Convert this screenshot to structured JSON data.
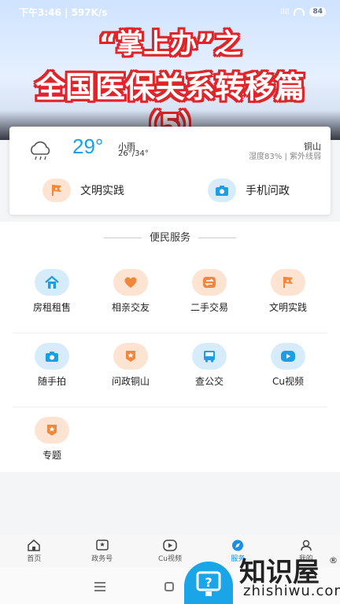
{
  "status_bar": {
    "time_speed": "下午3:46 | 597K/s",
    "signal": "llll",
    "battery": "84"
  },
  "banner": {
    "line1": "“掌上办”之",
    "line2": "全国医保关系转移篇",
    "line3": "（5）"
  },
  "weather": {
    "temperature": "29°",
    "condition": "小雨",
    "range": "26°/34°",
    "city": "铜山",
    "detail": "湿度83% | 紫外线弱",
    "icon": "cloud-rain-icon"
  },
  "quick_links": [
    {
      "label": "文明实践",
      "icon": "flag-icon"
    },
    {
      "label": "手机问政",
      "icon": "camera-icon"
    }
  ],
  "services": {
    "title": "便民服务",
    "rows": [
      [
        {
          "label": "房租租售",
          "icon": "house-icon",
          "tone": "blue"
        },
        {
          "label": "相亲交友",
          "icon": "heart-icon",
          "tone": "orange"
        },
        {
          "label": "二手交易",
          "icon": "exchange-icon",
          "tone": "orange"
        },
        {
          "label": "文明实践",
          "icon": "flag-icon",
          "tone": "orange"
        }
      ],
      [
        {
          "label": "随手拍",
          "icon": "camera-icon",
          "tone": "blue"
        },
        {
          "label": "问政铜山",
          "icon": "badge-star-icon",
          "tone": "orange"
        },
        {
          "label": "查公交",
          "icon": "bus-icon",
          "tone": "blue"
        },
        {
          "label": "Cu视频",
          "icon": "play-icon",
          "tone": "blue"
        }
      ],
      [
        {
          "label": "专题",
          "icon": "badge-star-icon",
          "tone": "orange"
        }
      ]
    ]
  },
  "bottom_nav": [
    {
      "label": "首页",
      "icon": "home-icon",
      "active": false
    },
    {
      "label": "政务号",
      "icon": "star-box-icon",
      "active": false
    },
    {
      "label": "Cu视频",
      "icon": "video-icon",
      "active": false
    },
    {
      "label": "服务",
      "icon": "compass-icon",
      "active": true
    },
    {
      "label": "我的",
      "icon": "user-icon",
      "active": false
    }
  ],
  "watermark": {
    "brand": "知识屋",
    "domain": "zhishiwu.com",
    "mark": "®"
  },
  "colors": {
    "accent": "#1aa0e8",
    "orange_icon": "#f0873a",
    "blue_icon": "#1a9fe3"
  }
}
